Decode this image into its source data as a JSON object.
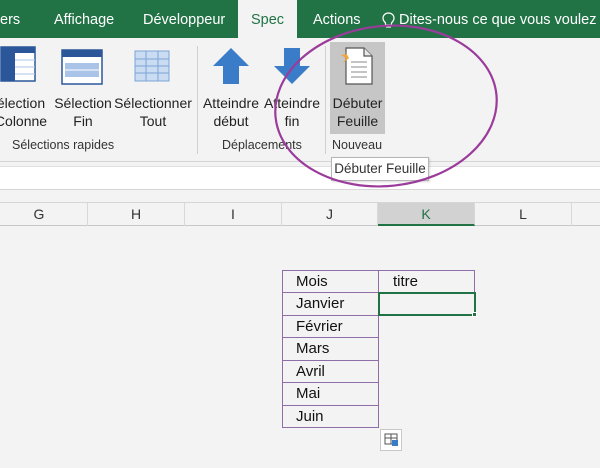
{
  "tabs": [
    {
      "label": "ers",
      "active": false
    },
    {
      "label": "Affichage",
      "active": false
    },
    {
      "label": "Développeur",
      "active": false
    },
    {
      "label": "Spec",
      "active": true
    },
    {
      "label": "Actions",
      "active": false
    }
  ],
  "tell_me": {
    "text": "Dites-nous ce que vous voulez fa",
    "icon": "lightbulb-icon"
  },
  "ribbon": {
    "groups": [
      {
        "label": "Sélections rapides",
        "buttons": [
          {
            "line1": "élection",
            "line2": "Colonne",
            "icon": "select-column-icon"
          },
          {
            "line1": "Sélection",
            "line2": "Fin",
            "icon": "select-end-icon"
          },
          {
            "line1": "Sélectionner",
            "line2": "Tout",
            "icon": "select-all-icon"
          }
        ]
      },
      {
        "label": "Déplacements",
        "buttons": [
          {
            "line1": "Atteindre",
            "line2": "début",
            "icon": "arrow-up-icon"
          },
          {
            "line1": "Atteindre",
            "line2": "fin",
            "icon": "arrow-down-icon"
          }
        ]
      },
      {
        "label": "Nouveau",
        "buttons": [
          {
            "line1": "Débuter",
            "line2": "Feuille",
            "icon": "new-sheet-icon",
            "highlighted": true
          }
        ]
      }
    ]
  },
  "tooltip": "Débuter Feuille",
  "columns": [
    "G",
    "H",
    "I",
    "J",
    "K",
    "L"
  ],
  "selected_column": "K",
  "table": {
    "rows": [
      "Mois",
      "Janvier",
      "Février",
      "Mars",
      "Avril",
      "Mai",
      "Juin"
    ],
    "k1": "titre"
  },
  "colors": {
    "ribbon_green": "#217346",
    "table_border": "#8e6ea8",
    "annotation": "#9b3b9b"
  }
}
